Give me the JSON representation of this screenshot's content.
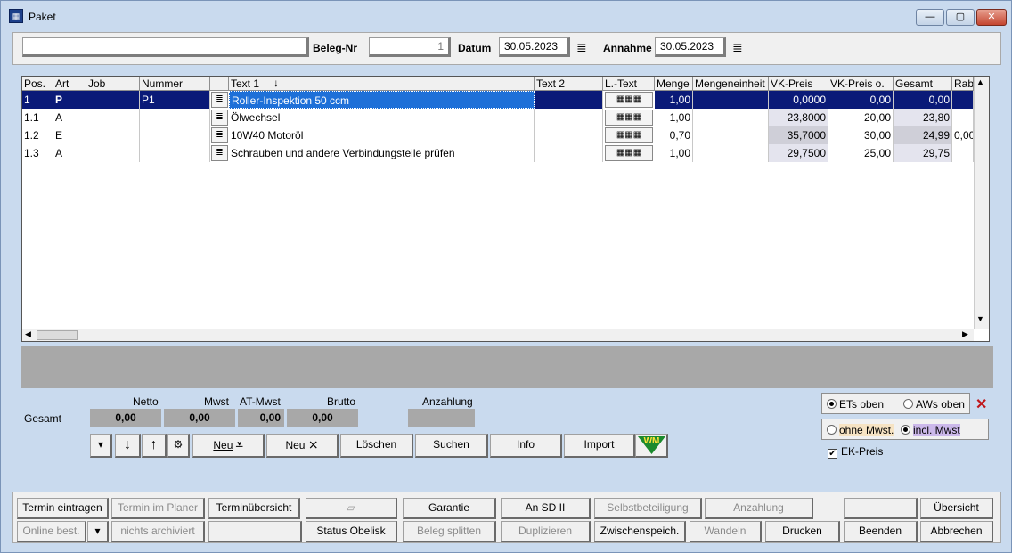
{
  "window": {
    "title": "Paket",
    "min": "—",
    "max": "▢",
    "close": "✕"
  },
  "header": {
    "search_value": "",
    "beleg_label": "Beleg-Nr",
    "beleg_value": "1",
    "datum_label": "Datum",
    "datum_value": "30.05.2023",
    "annahme_label": "Annahme",
    "annahme_value": "30.05.2023"
  },
  "table": {
    "columns": [
      "Pos.",
      "Art",
      "Job",
      "Nummer",
      "",
      "Text 1",
      "Text 2",
      "L.-Text",
      "Menge",
      "Mengeneinheit",
      "VK-Preis",
      "VK-Preis o.",
      "Gesamt",
      "Rab"
    ],
    "rows": [
      {
        "pos": "1",
        "art": "P",
        "job": "",
        "nummer": "P1",
        "text1": "Roller-Inspektion 50 ccm",
        "text2": "",
        "menge": "1,00",
        "einheit": "",
        "vk": "0,0000",
        "vko": "0,00",
        "gesamt": "0,00",
        "rab": ""
      },
      {
        "pos": "1.1",
        "art": "A",
        "job": "",
        "nummer": "",
        "text1": "Ölwechsel",
        "text2": "",
        "menge": "1,00",
        "einheit": "",
        "vk": "23,8000",
        "vko": "20,00",
        "gesamt": "23,80",
        "rab": ""
      },
      {
        "pos": "1.2",
        "art": "E",
        "job": "",
        "nummer": "",
        "text1": "10W40 Motoröl",
        "text2": "",
        "menge": "0,70",
        "einheit": "",
        "vk": "35,7000",
        "vko": "30,00",
        "gesamt": "24,99",
        "rab": "0,00"
      },
      {
        "pos": "1.3",
        "art": "A",
        "job": "",
        "nummer": "",
        "text1": "Schrauben und andere Verbindungsteile prüfen",
        "text2": "",
        "menge": "1,00",
        "einheit": "",
        "vk": "29,7500",
        "vko": "25,00",
        "gesamt": "29,75",
        "rab": ""
      }
    ]
  },
  "totals": {
    "gesamt_label": "Gesamt",
    "netto_label": "Netto",
    "netto": "0,00",
    "mwst_label": "Mwst",
    "mwst": "0,00",
    "atmwst_label": "AT-Mwst",
    "atmwst": "0,00",
    "brutto_label": "Brutto",
    "brutto": "0,00",
    "anzahlung_label": "Anzahlung",
    "anzahlung": ""
  },
  "actions": {
    "neu1": "Neu",
    "neu2": "Neu",
    "loeschen": "Löschen",
    "suchen": "Suchen",
    "info": "Info",
    "import": "Import",
    "wm": "WM"
  },
  "options": {
    "ets_oben": "ETs oben",
    "aws_oben": "AWs oben",
    "ohne_mwst": "ohne Mwst.",
    "incl_mwst": "incl. Mwst",
    "ek_preis": "EK-Preis"
  },
  "bottom_row1": [
    "Termin eintragen",
    "Termin im Planer",
    "Terminübersicht",
    "",
    "Garantie",
    "An SD II",
    "Selbstbeteiligung",
    "Anzahlung",
    "",
    "Übersicht"
  ],
  "bottom_row2": [
    "Online best.",
    "▾",
    "nichts archiviert",
    "",
    "Status Obelisk",
    "Beleg splitten",
    "Duplizieren",
    "Zwischenspeich.",
    "Wandeln",
    "Drucken",
    "Beenden",
    "Abbrechen"
  ],
  "colors": {
    "selection": "#0a1a78",
    "background": "#c9daee",
    "wm_green": "#1b8a2e"
  }
}
